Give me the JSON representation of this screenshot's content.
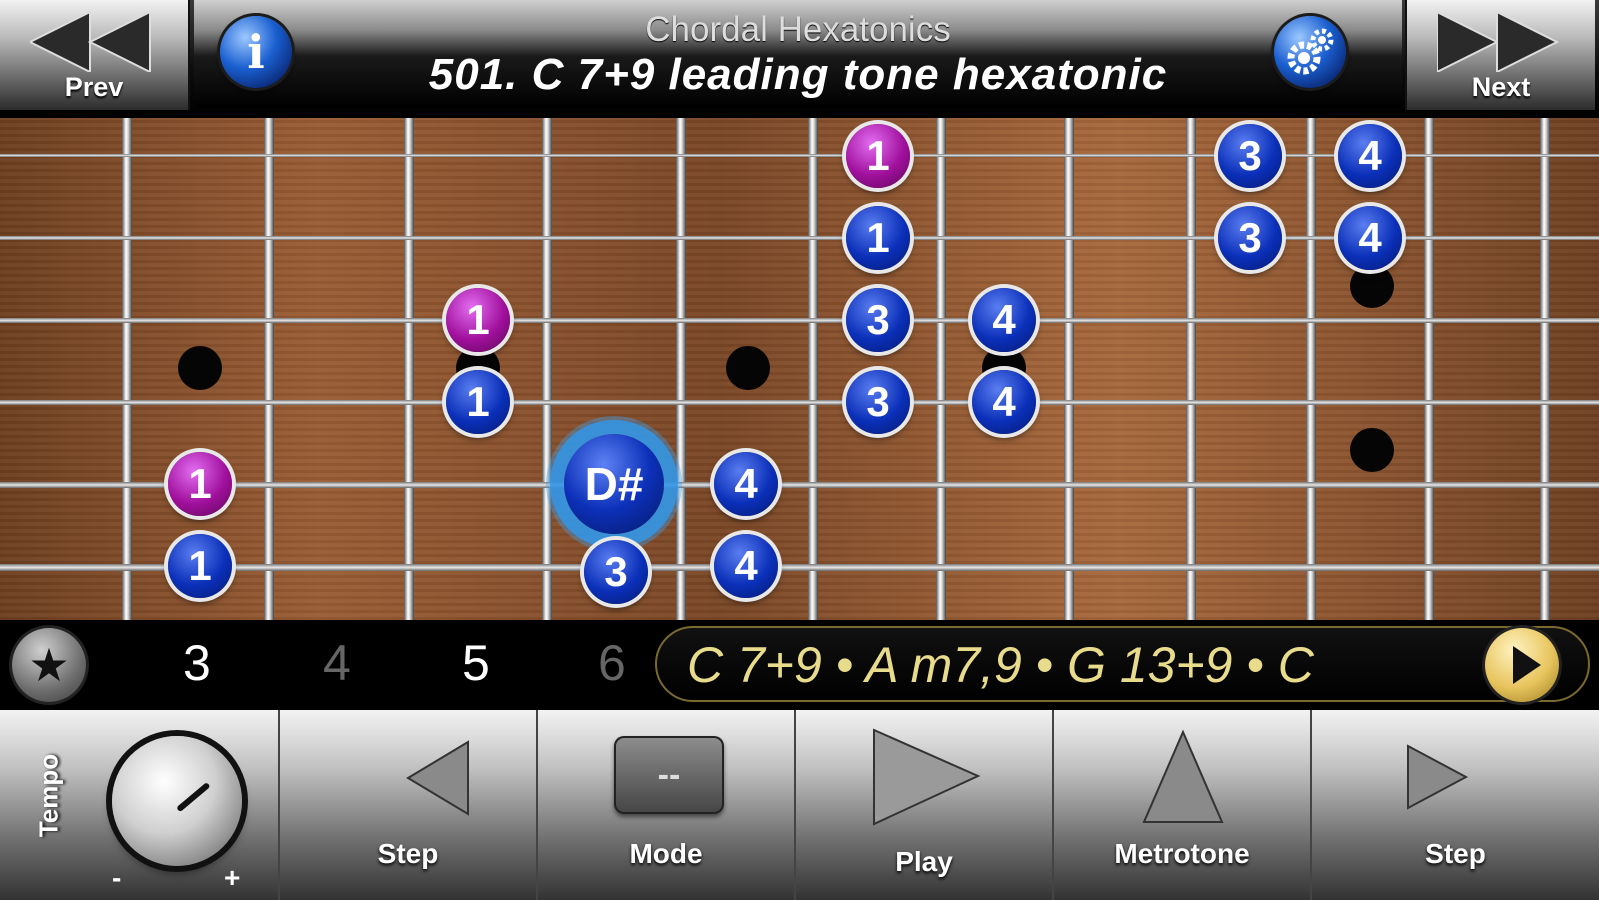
{
  "header": {
    "prev_label": "Prev",
    "next_label": "Next",
    "subtitle": "Chordal Hexatonics",
    "title": "501. C 7+9 leading tone hexatonic",
    "info_icon": "info-icon",
    "settings_icon": "gear-icon"
  },
  "fretboard": {
    "notes": [
      {
        "label": "1",
        "color": "purple"
      },
      {
        "label": "3",
        "color": "blue"
      },
      {
        "label": "4",
        "color": "blue"
      },
      {
        "label": "1",
        "color": "blue"
      },
      {
        "label": "3",
        "color": "blue"
      },
      {
        "label": "4",
        "color": "blue"
      },
      {
        "label": "1",
        "color": "purple"
      },
      {
        "label": "3",
        "color": "blue"
      },
      {
        "label": "4",
        "color": "blue"
      },
      {
        "label": "1",
        "color": "blue"
      },
      {
        "label": "3",
        "color": "blue"
      },
      {
        "label": "4",
        "color": "blue"
      },
      {
        "label": "1",
        "color": "purple"
      },
      {
        "label": "D#",
        "color": "blue",
        "active": true
      },
      {
        "label": "4",
        "color": "blue"
      },
      {
        "label": "1",
        "color": "blue"
      },
      {
        "label": "3",
        "color": "blue"
      },
      {
        "label": "4",
        "color": "blue"
      }
    ]
  },
  "positions": {
    "star_icon": "star-icon",
    "items": [
      {
        "label": "3",
        "dim": false
      },
      {
        "label": "4",
        "dim": true
      },
      {
        "label": "5",
        "dim": false
      },
      {
        "label": "6",
        "dim": true
      }
    ]
  },
  "chord_progression": {
    "text": "C 7+9 • A m7,9 • G 13+9 • C",
    "play_icon": "play-circle-icon"
  },
  "controls": {
    "tempo_label": "Tempo",
    "tempo_minus": "-",
    "tempo_plus": "+",
    "step_back_label": "Step",
    "mode_label": "Mode",
    "mode_display": "--",
    "play_label": "Play",
    "metrotone_label": "Metrotone",
    "step_forward_label": "Step"
  },
  "colors": {
    "note_blue": "#0a2fb8",
    "note_purple": "#a0109c",
    "active_glow": "#3296e6",
    "chord_text": "#e8dc8c"
  }
}
